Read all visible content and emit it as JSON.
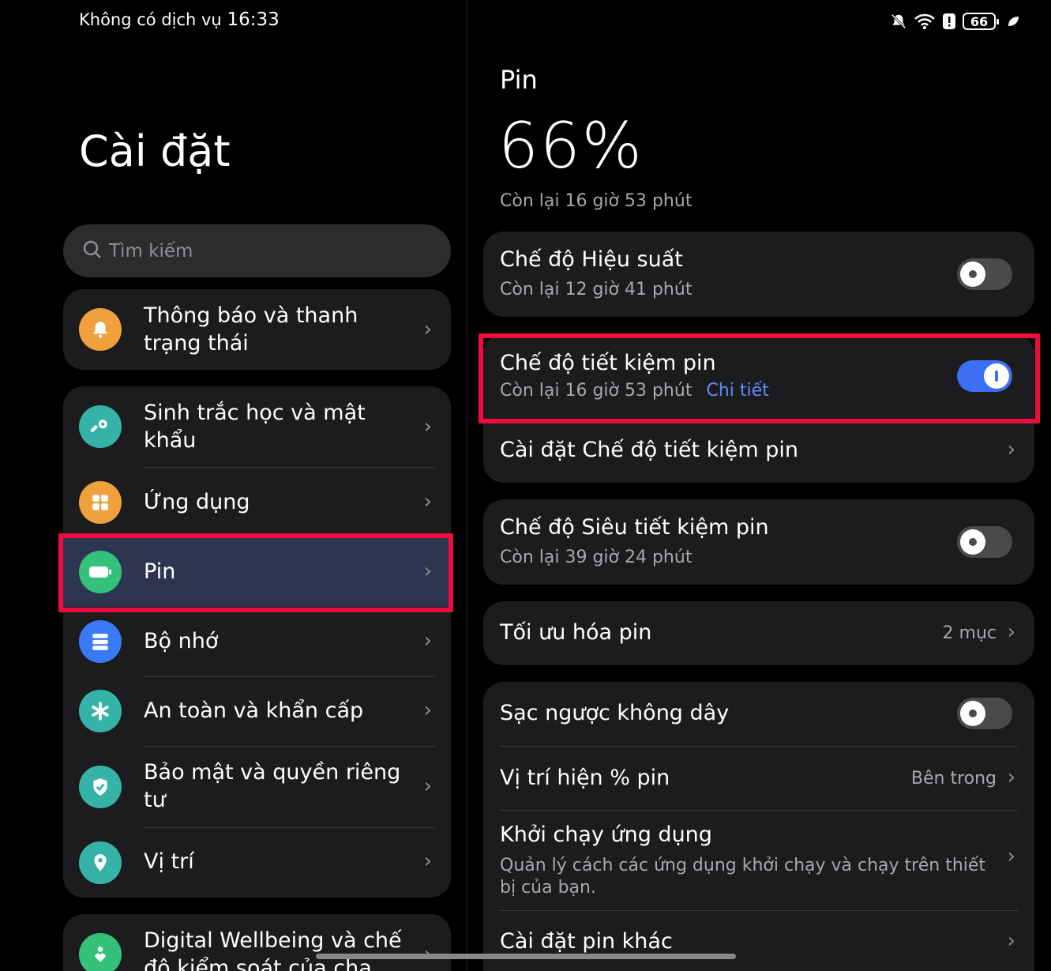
{
  "status": {
    "carrier": "Không có dịch vụ",
    "time": "16:33",
    "battery": "66"
  },
  "left": {
    "title": "Cài đặt",
    "search_placeholder": "Tìm kiếm",
    "items": [
      {
        "label": "Thông báo và thanh trạng thái",
        "icon": "bell-icon",
        "color": "#f0a03c"
      },
      {
        "label": "Sinh trắc học và mật khẩu",
        "icon": "key-icon",
        "color": "#36b3a8"
      },
      {
        "label": "Ứng dụng",
        "icon": "apps-icon",
        "color": "#f0a03c"
      },
      {
        "label": "Pin",
        "icon": "battery-icon",
        "color": "#34c27a"
      },
      {
        "label": "Bộ nhớ",
        "icon": "storage-icon",
        "color": "#3b7af5"
      },
      {
        "label": "An toàn và khẩn cấp",
        "icon": "asterisk-icon",
        "color": "#36b3a8"
      },
      {
        "label": "Bảo mật và quyền riêng tư",
        "icon": "shield-icon",
        "color": "#36b3a8"
      },
      {
        "label": "Vị trí",
        "icon": "location-icon",
        "color": "#36b3a8"
      },
      {
        "label": "Digital Wellbeing và chế độ kiểm soát của cha mẹ",
        "icon": "heart-person-icon",
        "color": "#34c27a"
      }
    ]
  },
  "right": {
    "title": "Pin",
    "percent": "66%",
    "remaining": "Còn lại 16 giờ 53 phút",
    "performance": {
      "title": "Chế độ Hiệu suất",
      "subtitle": "Còn lại 12 giờ 41 phút",
      "on": false
    },
    "saver": {
      "title": "Chế độ tiết kiệm pin",
      "subtitle": "Còn lại 16 giờ 53 phút",
      "link": "Chi tiết",
      "on": true
    },
    "saver_settings": "Cài đặt Chế độ tiết kiệm pin",
    "ultra": {
      "title": "Chế độ Siêu tiết kiệm pin",
      "subtitle": "Còn lại 39 giờ 24 phút",
      "on": false
    },
    "optimize": {
      "title": "Tối ưu hóa pin",
      "value": "2 mục"
    },
    "reverse": {
      "title": "Sạc ngược không dây",
      "on": false
    },
    "percent_pos": {
      "title": "Vị trí hiện % pin",
      "value": "Bên trong"
    },
    "startup": {
      "title": "Khởi chạy ứng dụng",
      "subtitle": "Quản lý cách các ứng dụng khởi chạy và chạy trên thiết bị của bạn."
    },
    "other": "Cài đặt pin khác"
  },
  "colors": {
    "accent": "#3c6ff5",
    "highlight": "#ee0c3e",
    "link": "#5b8cff"
  }
}
